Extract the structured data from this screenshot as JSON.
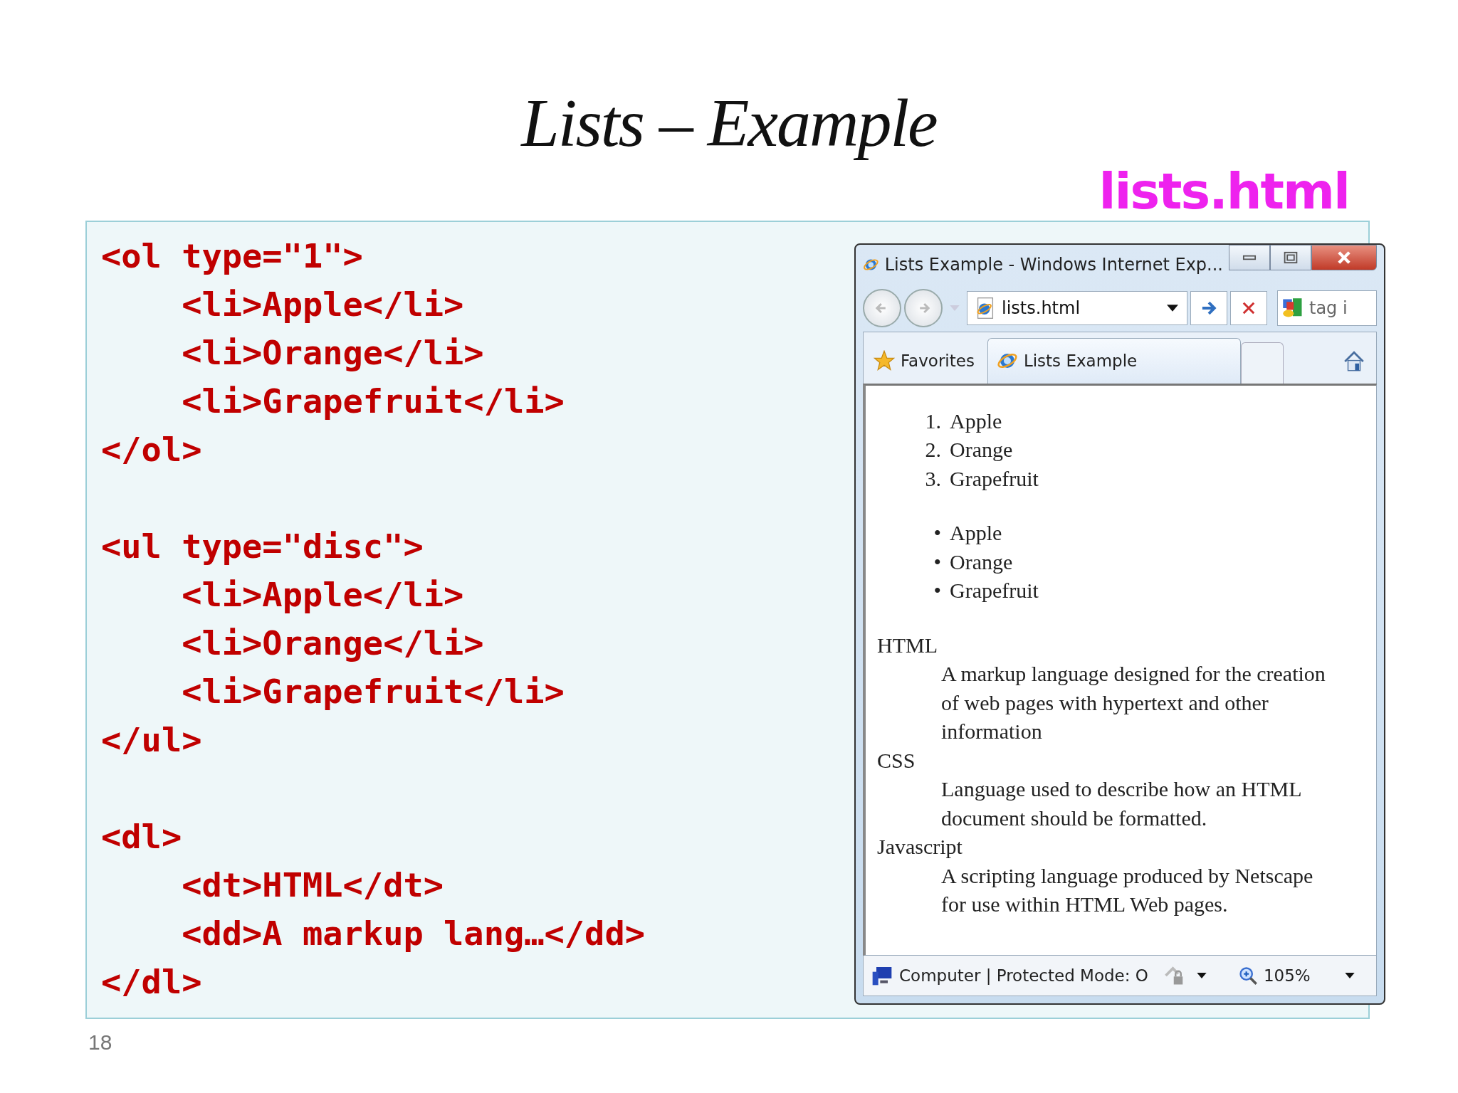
{
  "slide": {
    "title": "Lists – Example",
    "file_label": "lists.html",
    "page_number": "18"
  },
  "code_blocks": [
    [
      "<ol type=\"1\">",
      "    <li>Apple</li>",
      "    <li>Orange</li>",
      "    <li>Grapefruit</li>",
      "</ol>"
    ],
    [
      "<ul type=\"disc\">",
      "    <li>Apple</li>",
      "    <li>Orange</li>",
      "    <li>Grapefruit</li>",
      "</ul>"
    ],
    [
      "<dl>",
      "    <dt>HTML</dt>",
      "    <dd>A markup lang…</dd>",
      "</dl>"
    ]
  ],
  "browser": {
    "title": "Lists Example - Windows Internet Exp...",
    "address": "lists.html",
    "search_text": "tag i",
    "favorites_label": "Favorites",
    "tab_label": "Lists Example",
    "status_text": "Computer | Protected Mode: O",
    "zoom": "105%",
    "ordered_list": [
      {
        "marker": "1.",
        "text": "Apple"
      },
      {
        "marker": "2.",
        "text": "Orange"
      },
      {
        "marker": "3.",
        "text": "Grapefruit"
      }
    ],
    "unordered_list": [
      {
        "marker": "•",
        "text": "Apple"
      },
      {
        "marker": "•",
        "text": "Orange"
      },
      {
        "marker": "•",
        "text": "Grapefruit"
      }
    ],
    "definitions": [
      {
        "term": "HTML",
        "description": "A markup language designed for the creation of web pages with hypertext and other information"
      },
      {
        "term": "CSS",
        "description": "Language used to describe how an HTML document should be formatted."
      },
      {
        "term": "Javascript",
        "description": "A scripting language produced by Netscape for use within HTML Web pages."
      }
    ]
  }
}
